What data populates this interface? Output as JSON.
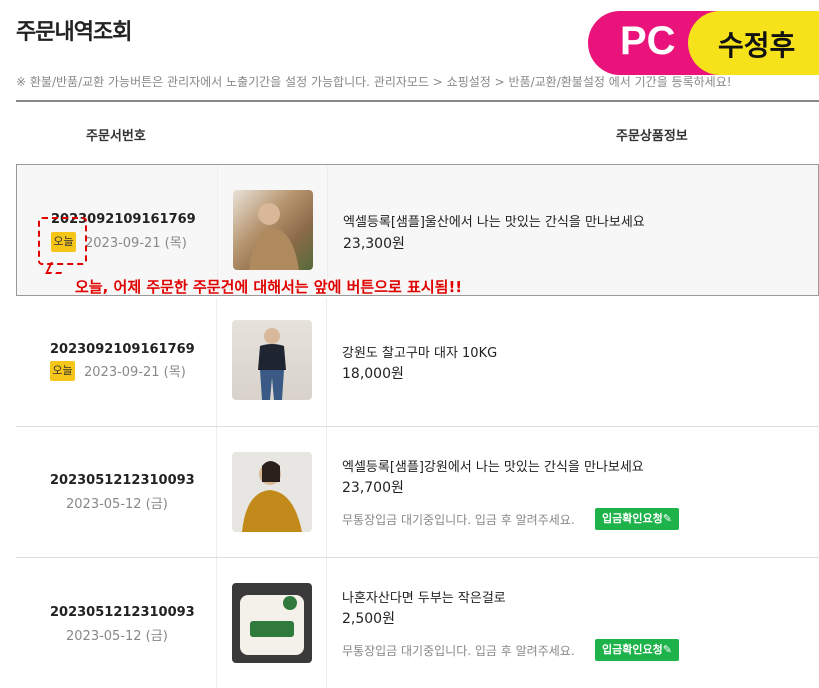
{
  "page": {
    "title": "주문내역조회",
    "notice": "※ 환불/반품/교환 가능버튼은 관리자에서 노출기간을 설정 가능합니다. 관리자모드 > 쇼핑설정 > 반품/교환/환불설정 에서 기간을 등록하세요!",
    "col_order": "주문서번호",
    "col_product": "주문상품정보"
  },
  "badges": {
    "pc": "PC",
    "fixed": "수정후"
  },
  "annotation": "오늘, 어제 주문한 주문건에 대해서는 앞에 버튼으로 표시됨!!",
  "orders": [
    {
      "order_no": "2023092109161769",
      "tag": "오늘",
      "date": "2023-09-21 (목)",
      "product": "엑셀등록[샘플]울산에서 나는 맛있는 간식을 만나보세요",
      "price": "23,300원"
    },
    {
      "order_no": "2023092109161769",
      "tag": "오늘",
      "date": "2023-09-21 (목)",
      "product": "강원도 찰고구마 대자 10KG",
      "price": "18,000원"
    },
    {
      "order_no": "2023051212310093",
      "date": "2023-05-12 (금)",
      "product": "엑셀등록[샘플]강원에서 나는 맛있는 간식을 만나보세요",
      "price": "23,700원",
      "pay_note": "무통장입금 대기중입니다. 입금 후 알려주세요.",
      "pay_button": "입금확인요청✎"
    },
    {
      "order_no": "2023051212310093",
      "date": "2023-05-12 (금)",
      "product": "나혼자산다면 두부는 작은걸로",
      "price": "2,500원",
      "pay_note": "무통장입금 대기중입니다. 입금 후 알려주세요.",
      "pay_button": "입금확인요청✎"
    }
  ]
}
